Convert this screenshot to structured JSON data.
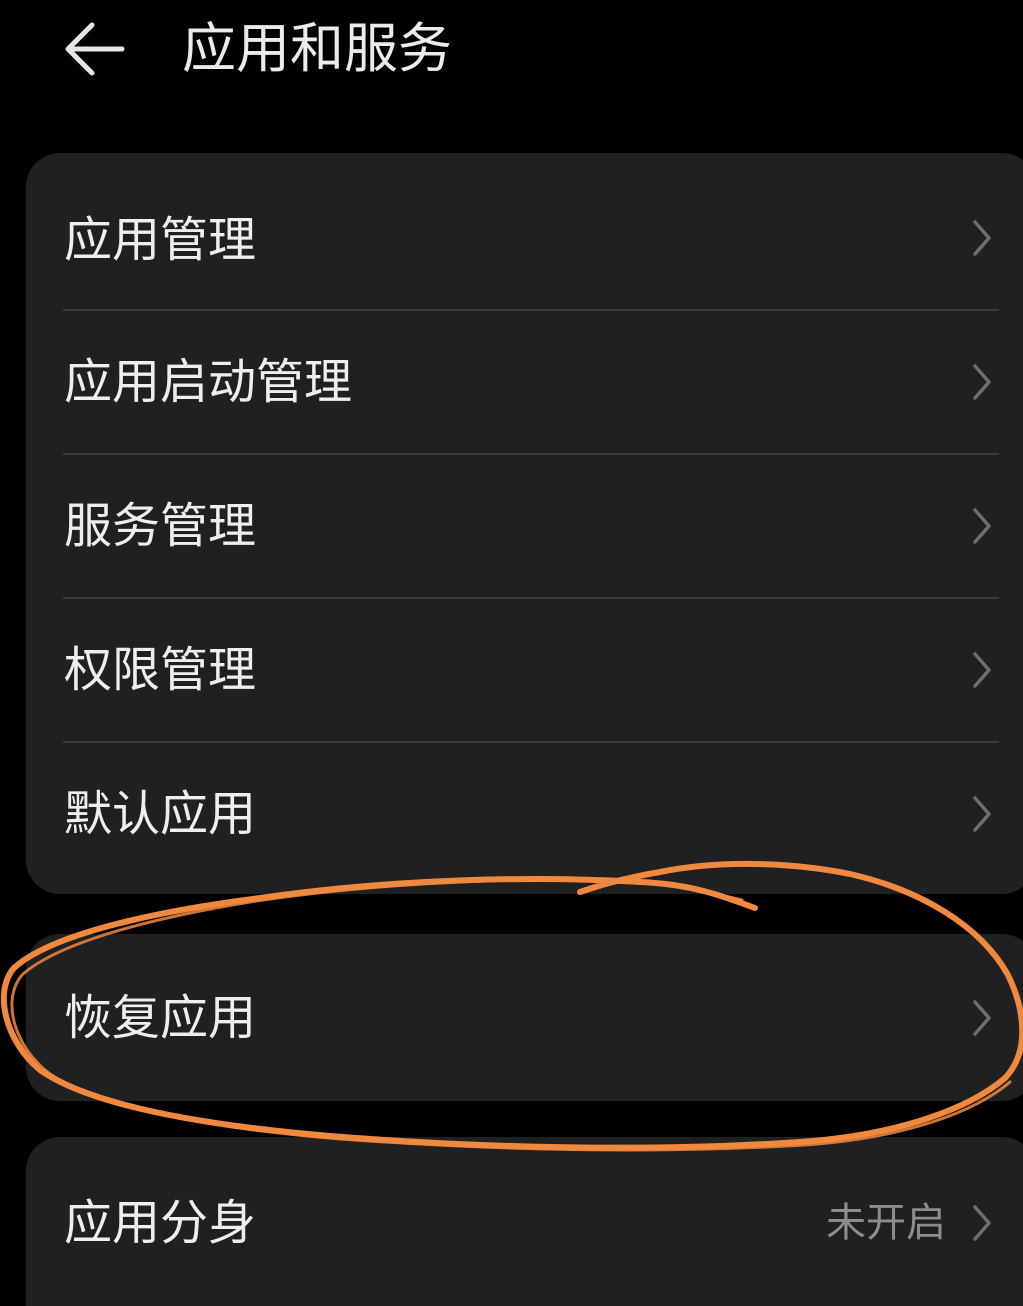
{
  "header": {
    "title": "应用和服务",
    "back_icon": "arrow-left-icon"
  },
  "menu": {
    "items": [
      {
        "label": "应用管理"
      },
      {
        "label": "应用启动管理"
      },
      {
        "label": "服务管理"
      },
      {
        "label": "权限管理"
      },
      {
        "label": "默认应用"
      }
    ]
  },
  "restore": {
    "label": "恢复应用"
  },
  "clone": {
    "label": "应用分身",
    "value": "未开启"
  },
  "chevron_icon": "chevron-right-icon",
  "annotation": {
    "shape": "hand-drawn-ellipse",
    "color": "#f0883e"
  },
  "colors": {
    "background": "#000000",
    "card": "#1f2022",
    "text": "#eeeeee",
    "secondary_text": "#8c8d8f",
    "divider": "#3a3b3e"
  }
}
